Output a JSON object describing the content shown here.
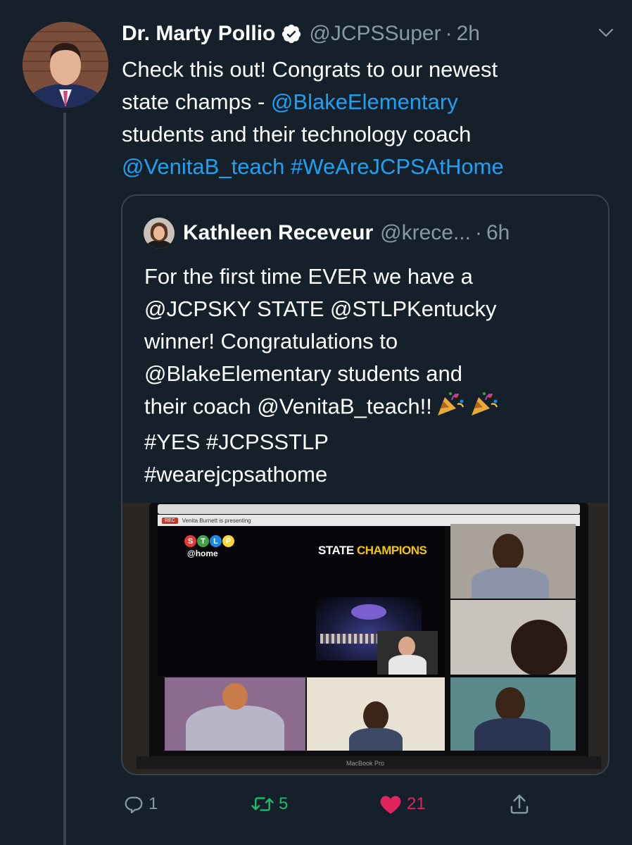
{
  "tweet": {
    "author_name": "Dr. Marty Pollio",
    "handle": "@JCPSSuper",
    "separator": "·",
    "time": "2h",
    "text_lines": [
      [
        {
          "text": "Check this out! Congrats to our newest",
          "link": false
        }
      ],
      [
        {
          "text": "state champs - ",
          "link": false
        },
        {
          "text": "@BlakeElementary",
          "link": true
        }
      ],
      [
        {
          "text": "students and their technology coach",
          "link": false
        }
      ],
      [
        {
          "text": "@VenitaB_teach",
          "link": true
        },
        {
          "text": " ",
          "link": false
        },
        {
          "text": "#WeAreJCPSAtHome",
          "link": true
        }
      ]
    ]
  },
  "quoted": {
    "author_name": "Kathleen Receveur",
    "handle": "@krece...",
    "separator": "·",
    "time": "6h",
    "text_lines": [
      "For the first time EVER we have a",
      "@JCPSKY STATE  @STLPKentucky",
      "winner! Congratulations to",
      "@BlakeElementary students and",
      "their coach @VenitaB_teach!!",
      "#YES #JCPSSTLP",
      "#wearejcpsathome"
    ],
    "media": {
      "rec_label": "REC",
      "presenting_text": "Venita Burnett is presenting",
      "logo_letters": [
        "S",
        "T",
        "L",
        "P"
      ],
      "logo_colors": [
        "#e53935",
        "#43a047",
        "#1e88e5",
        "#fdd835"
      ],
      "logo_suffix": "@home",
      "heading_white": "STATE ",
      "heading_gold": "CHAMPIONS",
      "device_label": "MacBook Pro"
    }
  },
  "actions": {
    "replies": "1",
    "retweets": "5",
    "likes": "21"
  },
  "colors": {
    "background": "#15202b",
    "link": "#1da1f2",
    "muted": "#8899a6",
    "border": "#38444d",
    "retweet": "#17bf63",
    "like": "#e0245e"
  },
  "icons": [
    "verified-badge-icon",
    "chevron-down-icon",
    "party-popper-icon",
    "reply-icon",
    "retweet-icon",
    "heart-icon",
    "share-icon"
  ]
}
